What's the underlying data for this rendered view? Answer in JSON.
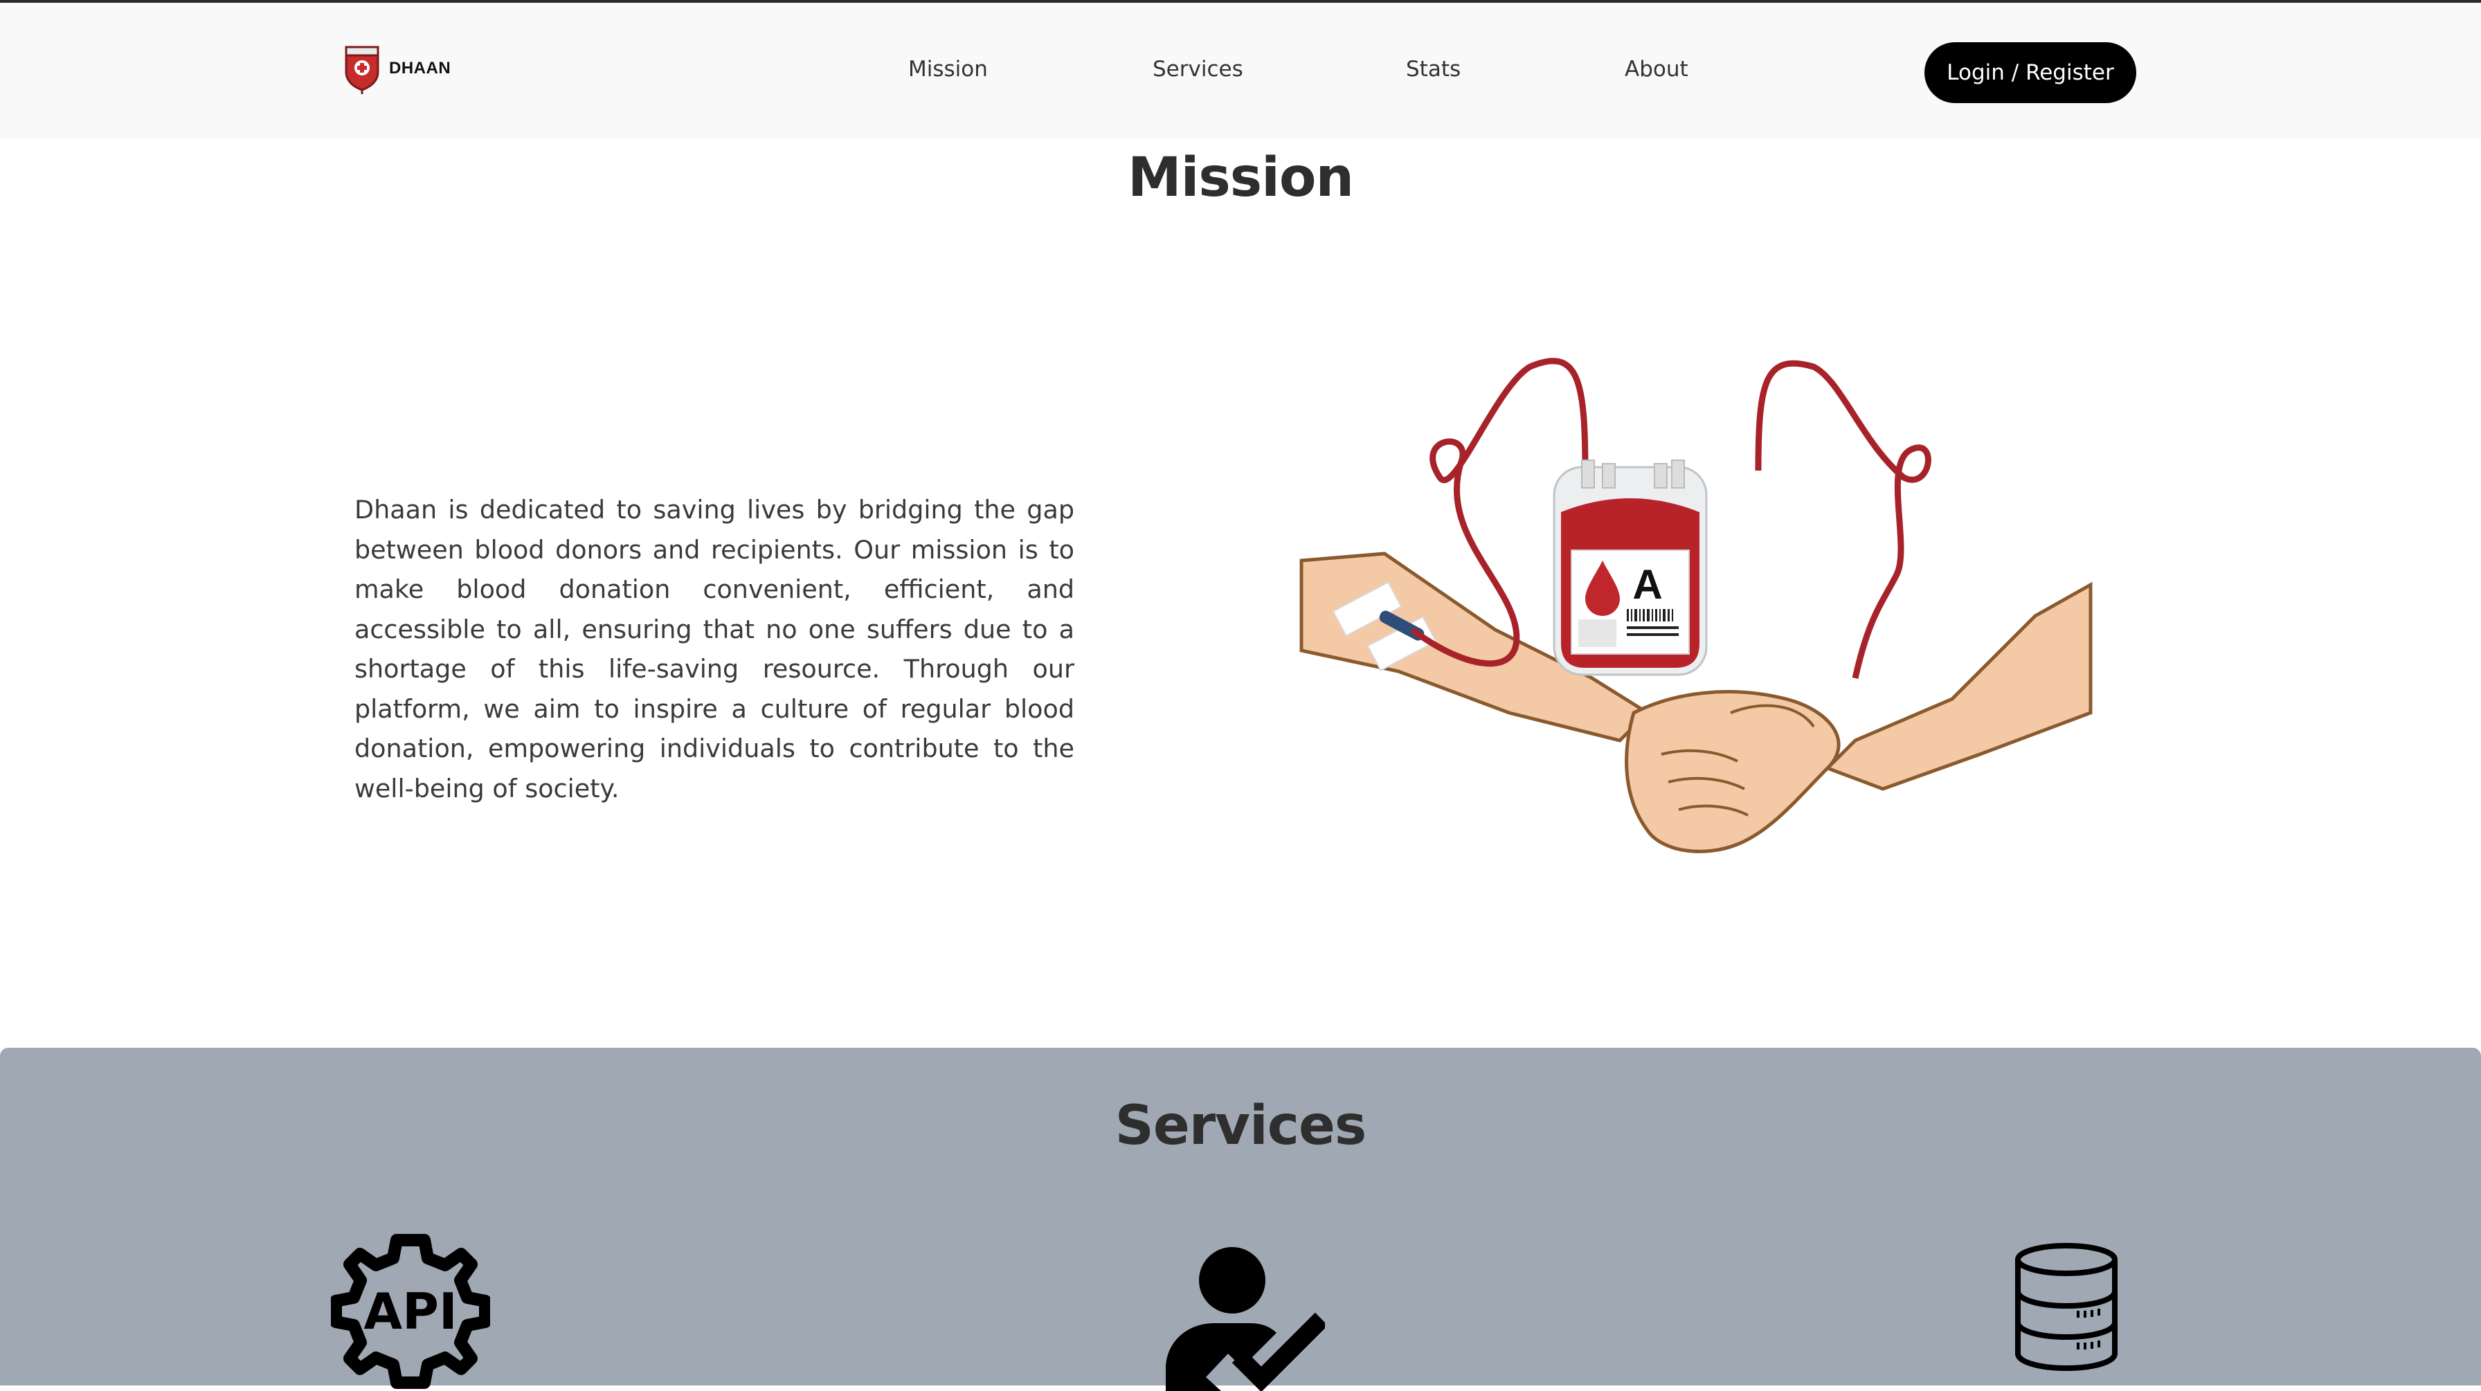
{
  "header": {
    "logo_text": "DHAAN",
    "nav": [
      {
        "label": "Mission"
      },
      {
        "label": "Services"
      },
      {
        "label": "Stats"
      },
      {
        "label": "About"
      }
    ],
    "login_label": "Login / Register"
  },
  "mission": {
    "title": "Mission",
    "text": "Dhaan is dedicated to saving lives by bridging the gap between blood donors and recipients. Our mission is to make blood donation convenient, efficient, and accessible to all, ensuring that no one suffers due to a shortage of this life-saving resource. Through our platform, we aim to inspire a culture of regular blood donation, empowering individuals to contribute to the well-being of society.",
    "bag_label": "A"
  },
  "services": {
    "title": "Services",
    "icons": [
      {
        "name": "api-gear-icon",
        "text": "API"
      },
      {
        "name": "user-check-icon"
      },
      {
        "name": "database-icon"
      }
    ]
  },
  "colors": {
    "header_bg": "#f9f9f9",
    "services_bg": "#a0a9b3",
    "button_bg": "#000000",
    "blood_red": "#b8232a"
  }
}
